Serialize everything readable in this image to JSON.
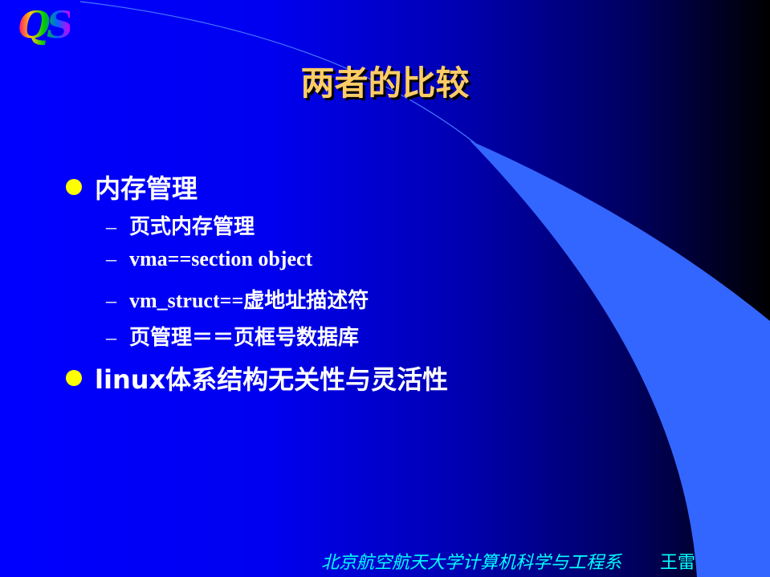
{
  "logo": {
    "text": "QS"
  },
  "title": "两者的比较",
  "bullets": [
    {
      "text": "内存管理",
      "children": [
        "页式内存管理",
        "vma==section object",
        "vm_struct==虚地址描述符",
        "页管理＝＝页框号数据库"
      ]
    },
    {
      "text": "linux体系结构无关性与灵活性",
      "children": []
    }
  ],
  "footer": {
    "institution": "北京航空航天大学计算机科学与工程系",
    "author": "王雷"
  },
  "colors": {
    "title": "#ffcc66",
    "bullet": "#ffff00",
    "footer": "#00ffff",
    "swoosh": "#3366ff"
  }
}
